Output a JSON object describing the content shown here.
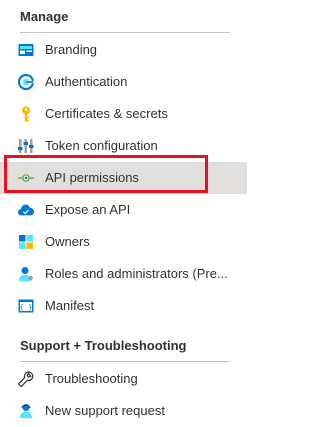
{
  "colors": {
    "selected_bg": "#e1dfdd",
    "highlight_border": "#e81123",
    "azure_blue": "#0078d4"
  },
  "sections": {
    "manage_title": "Manage",
    "support_title": "Support + Troubleshooting"
  },
  "items": [
    {
      "label": "Branding",
      "icon": "branding-icon"
    },
    {
      "label": "Authentication",
      "icon": "authentication-icon"
    },
    {
      "label": "Certificates & secrets",
      "icon": "key-icon"
    },
    {
      "label": "Token configuration",
      "icon": "token-configuration-icon"
    },
    {
      "label": "API permissions",
      "icon": "api-permissions-icon",
      "selected": true
    },
    {
      "label": "Expose an API",
      "icon": "cloud-icon"
    },
    {
      "label": "Owners",
      "icon": "owners-icon"
    },
    {
      "label": "Roles and administrators (Pre...",
      "icon": "user-role-icon"
    },
    {
      "label": "Manifest",
      "icon": "manifest-icon"
    }
  ],
  "support_items": [
    {
      "label": "Troubleshooting",
      "icon": "wrench-icon"
    },
    {
      "label": "New support request",
      "icon": "support-person-icon"
    }
  ]
}
